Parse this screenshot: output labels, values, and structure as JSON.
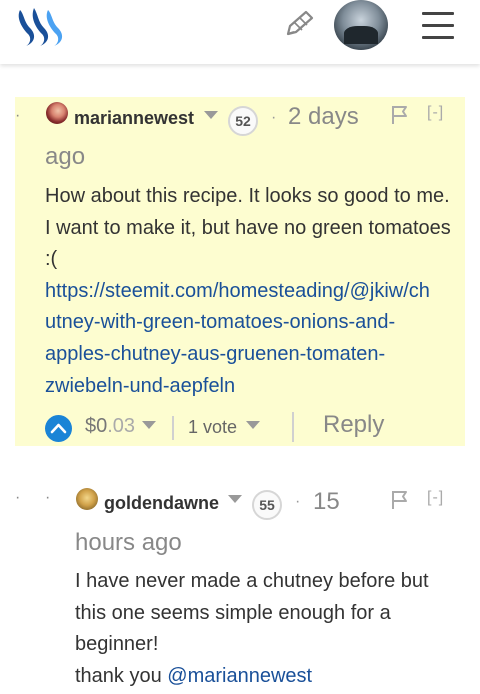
{
  "header": {
    "logo_icon": "steemit-logo-icon",
    "compose_icon": "pencil-icon",
    "avatar_icon": "user-avatar-icon",
    "menu_icon": "hamburger-menu-icon"
  },
  "comment1": {
    "author": "mariannewest",
    "reputation": "52",
    "time_separator": "·",
    "time_part1": "2 days",
    "time_part2": "ago",
    "collapse_label": "[-]",
    "body_lines": [
      "How about this recipe. It looks so good to me.",
      "I want to make it, but have no green tomatoes",
      ":("
    ],
    "link_lines": [
      "https://steemit.com/homesteading/@jkiw/ch",
      "utney-with-green-tomatoes-onions-and-",
      "apples-chutney-aus-gruenen-tomaten-",
      "zwiebeln-und-aepfeln"
    ],
    "payout_dollars": "$0",
    "payout_cents": ".03",
    "votes_label": "1 vote",
    "reply_label": "Reply"
  },
  "comment2": {
    "author": "goldendawne",
    "reputation": "55",
    "time_separator": "·",
    "time_part1": "15",
    "time_part2": "hours ago",
    "collapse_label": "[-]",
    "body_lines": [
      "I have never made a chutney before but",
      "this one seems simple enough for a",
      "beginner!"
    ],
    "thanks_prefix": "thank you ",
    "mention": "@mariannewest"
  },
  "colors": {
    "highlight_bg": "#fdfdd0",
    "link": "#1a5099",
    "upvote": "#1a84d6"
  }
}
